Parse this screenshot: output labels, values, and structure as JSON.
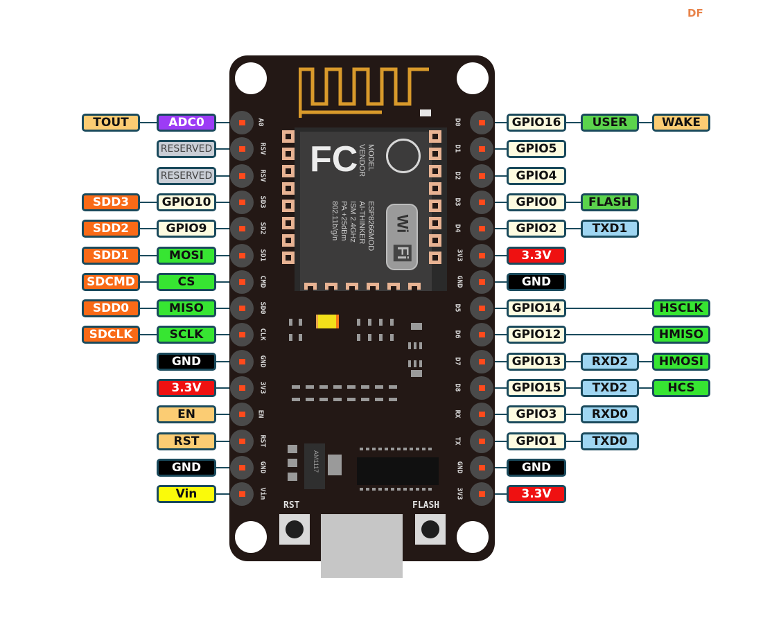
{
  "watermark": "DF",
  "colors": {
    "board": "#231815",
    "gpio": "#fdfbe0",
    "adc": "#9c3cf5",
    "reserved": "#c9ced6",
    "sd": "#f96a17",
    "spi": "#37e532",
    "power": "#ef1111",
    "ground": "#000000",
    "control": "#fbcc73",
    "vin": "#fafa0a",
    "uart": "#9fd6f2",
    "special": "#5bd34c",
    "wake": "#fbcc73"
  },
  "board": {
    "module_model_label": "MODEL",
    "module_model": "ESP8266MOD",
    "module_vendor_label": "VENDOR",
    "module_vendor": "AI-THINKER",
    "module_freq": "ISM 2.4GHz",
    "module_power": "PA +25dBm",
    "module_std": "802.11b/g/n",
    "fcc_logo": "FC",
    "wifi_logo_top": "Wi",
    "wifi_logo_bottom": "Fi",
    "regulator_text": "AM1117",
    "button_rst": "RST",
    "button_flash": "FLASH"
  },
  "left_pins": [
    {
      "silk": "A0",
      "labels": [
        {
          "text": "ADC0",
          "kind": "adc"
        },
        {
          "text": "TOUT",
          "kind": "control"
        }
      ]
    },
    {
      "silk": "RSV",
      "labels": [
        {
          "text": "RESERVED",
          "kind": "reserved"
        }
      ]
    },
    {
      "silk": "RSV",
      "labels": [
        {
          "text": "RESERVED",
          "kind": "reserved"
        }
      ]
    },
    {
      "silk": "SD3",
      "labels": [
        {
          "text": "GPIO10",
          "kind": "gpio"
        },
        {
          "text": "SDD3",
          "kind": "sd"
        }
      ]
    },
    {
      "silk": "SD2",
      "labels": [
        {
          "text": "GPIO9",
          "kind": "gpio"
        },
        {
          "text": "SDD2",
          "kind": "sd"
        }
      ]
    },
    {
      "silk": "SD1",
      "labels": [
        {
          "text": "MOSI",
          "kind": "spi"
        },
        {
          "text": "SDD1",
          "kind": "sd"
        }
      ]
    },
    {
      "silk": "CMD",
      "labels": [
        {
          "text": "CS",
          "kind": "spi"
        },
        {
          "text": "SDCMD",
          "kind": "sd"
        }
      ]
    },
    {
      "silk": "SD0",
      "labels": [
        {
          "text": "MISO",
          "kind": "spi"
        },
        {
          "text": "SDD0",
          "kind": "sd"
        }
      ]
    },
    {
      "silk": "CLK",
      "labels": [
        {
          "text": "SCLK",
          "kind": "spi"
        },
        {
          "text": "SDCLK",
          "kind": "sd"
        }
      ]
    },
    {
      "silk": "GND",
      "labels": [
        {
          "text": "GND",
          "kind": "ground"
        }
      ]
    },
    {
      "silk": "3V3",
      "labels": [
        {
          "text": "3.3V",
          "kind": "power"
        }
      ]
    },
    {
      "silk": "EN",
      "labels": [
        {
          "text": "EN",
          "kind": "control"
        }
      ]
    },
    {
      "silk": "RST",
      "labels": [
        {
          "text": "RST",
          "kind": "control"
        }
      ]
    },
    {
      "silk": "GND",
      "labels": [
        {
          "text": "GND",
          "kind": "ground"
        }
      ]
    },
    {
      "silk": "Vin",
      "labels": [
        {
          "text": "Vin",
          "kind": "vin"
        }
      ]
    }
  ],
  "right_pins": [
    {
      "silk": "D0",
      "labels": [
        {
          "text": "GPIO16",
          "kind": "gpio"
        },
        {
          "text": "USER",
          "kind": "special"
        },
        {
          "text": "WAKE",
          "kind": "wake"
        }
      ]
    },
    {
      "silk": "D1",
      "labels": [
        {
          "text": "GPIO5",
          "kind": "gpio"
        }
      ]
    },
    {
      "silk": "D2",
      "labels": [
        {
          "text": "GPIO4",
          "kind": "gpio"
        }
      ]
    },
    {
      "silk": "D3",
      "labels": [
        {
          "text": "GPIO0",
          "kind": "gpio"
        },
        {
          "text": "FLASH",
          "kind": "special"
        }
      ]
    },
    {
      "silk": "D4",
      "labels": [
        {
          "text": "GPIO2",
          "kind": "gpio"
        },
        {
          "text": "TXD1",
          "kind": "uart"
        }
      ]
    },
    {
      "silk": "3V3",
      "labels": [
        {
          "text": "3.3V",
          "kind": "power"
        }
      ]
    },
    {
      "silk": "GND",
      "labels": [
        {
          "text": "GND",
          "kind": "ground"
        }
      ]
    },
    {
      "silk": "D5",
      "labels": [
        {
          "text": "GPIO14",
          "kind": "gpio"
        },
        null,
        {
          "text": "HSCLK",
          "kind": "spi"
        }
      ]
    },
    {
      "silk": "D6",
      "labels": [
        {
          "text": "GPIO12",
          "kind": "gpio"
        },
        null,
        {
          "text": "HMISO",
          "kind": "spi"
        }
      ]
    },
    {
      "silk": "D7",
      "labels": [
        {
          "text": "GPIO13",
          "kind": "gpio"
        },
        {
          "text": "RXD2",
          "kind": "uart"
        },
        {
          "text": "HMOSI",
          "kind": "spi"
        }
      ]
    },
    {
      "silk": "D8",
      "labels": [
        {
          "text": "GPIO15",
          "kind": "gpio"
        },
        {
          "text": "TXD2",
          "kind": "uart"
        },
        {
          "text": "HCS",
          "kind": "spi"
        }
      ]
    },
    {
      "silk": "RX",
      "labels": [
        {
          "text": "GPIO3",
          "kind": "gpio"
        },
        {
          "text": "RXD0",
          "kind": "uart"
        }
      ]
    },
    {
      "silk": "TX",
      "labels": [
        {
          "text": "GPIO1",
          "kind": "gpio"
        },
        {
          "text": "TXD0",
          "kind": "uart"
        }
      ]
    },
    {
      "silk": "GND",
      "labels": [
        {
          "text": "GND",
          "kind": "ground"
        }
      ]
    },
    {
      "silk": "3V3",
      "labels": [
        {
          "text": "3.3V",
          "kind": "power"
        }
      ]
    }
  ]
}
